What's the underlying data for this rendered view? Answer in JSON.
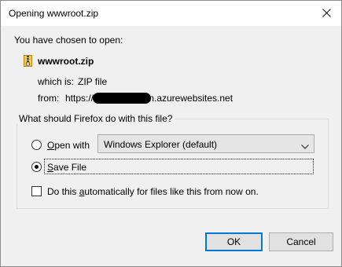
{
  "window": {
    "title": "Opening wwwroot.zip",
    "close_icon": "close-icon"
  },
  "intro": "You have chosen to open:",
  "file": {
    "icon": "zip-file-icon",
    "name": "wwwroot.zip",
    "which_is_label": "which is:",
    "which_is_value": "ZIP file",
    "from_label": "from:",
    "from_prefix": "https://",
    "from_suffix": "m.azurewebsites.net"
  },
  "question": {
    "legend": "What should Firefox do with this file?",
    "open_with": {
      "accel": "O",
      "rest": "pen with",
      "selected_app": "Windows Explorer (default)"
    },
    "save_file": {
      "accel": "S",
      "rest": "ave File",
      "selected": true
    },
    "auto": {
      "before": "Do this ",
      "accel": "a",
      "after": "utomatically for files like this from now on.",
      "checked": false
    }
  },
  "buttons": {
    "ok": "OK",
    "cancel": "Cancel"
  },
  "colors": {
    "dialog_bg": "#f0f0f0",
    "default_button_border": "#0078d7"
  }
}
